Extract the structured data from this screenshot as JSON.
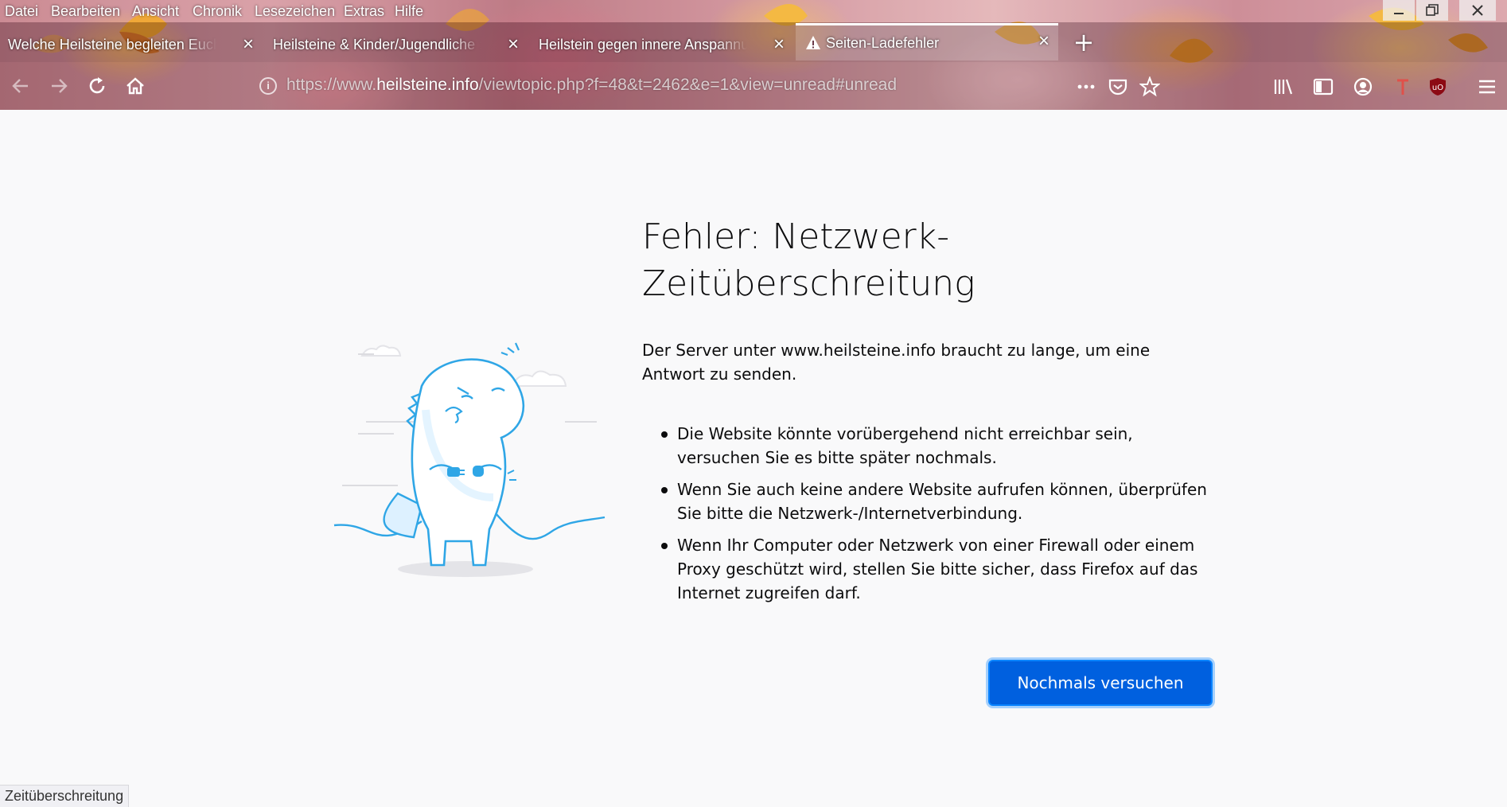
{
  "menubar": {
    "items": [
      "Datei",
      "Bearbeiten",
      "Ansicht",
      "Chronik",
      "Lesezeichen",
      "Extras",
      "Hilfe"
    ]
  },
  "window_controls": {
    "minimize_icon": "minimize-icon",
    "maximize_icon": "restore-icon",
    "close_icon": "close-icon"
  },
  "tabs": [
    {
      "label": "Welche Heilsteine begleiten Euch :",
      "active": false
    },
    {
      "label": "Heilsteine & Kinder/Jugendliche : H",
      "active": false
    },
    {
      "label": "Heilstein gegen innere Anspannung",
      "active": false
    },
    {
      "label": "Seiten-Ladefehler",
      "active": true,
      "icon": "warning-icon"
    }
  ],
  "new_tab_label": "+",
  "urlbar": {
    "prefix": "https://www.",
    "domain": "heilsteine.info",
    "suffix": "/viewtopic.php?f=48&t=2462&e=1&view=unread#unread"
  },
  "error": {
    "title": "Fehler: Netzwerk-Zeitüberschreitung",
    "title_line1": "Fehler: Netzwerk-",
    "title_line2": "Zeitüberschreitung",
    "description": "Der Server unter www.heilsteine.info braucht zu lange, um eine Antwort zu senden.",
    "suggestions": [
      "Die Website könnte vorübergehend nicht erreichbar sein, versuchen Sie es bitte später nochmals.",
      "Wenn Sie auch keine andere Website aufrufen können, überprüfen Sie bitte die Netzwerk-/Internetverbindung.",
      "Wenn Ihr Computer oder Netzwerk von einer Firewall oder einem Proxy geschützt wird, stellen Sie bitte sicher, dass Firefox auf das Internet zugreifen darf."
    ],
    "retry_label": "Nochmals versuchen"
  },
  "status_bar": {
    "text": "Zeitüberschreitung"
  },
  "colors": {
    "accent": "#0060df",
    "accent_focus": "#0a84ff",
    "illustration": "#2fa6e6",
    "page_background": "#f9f9fa"
  }
}
